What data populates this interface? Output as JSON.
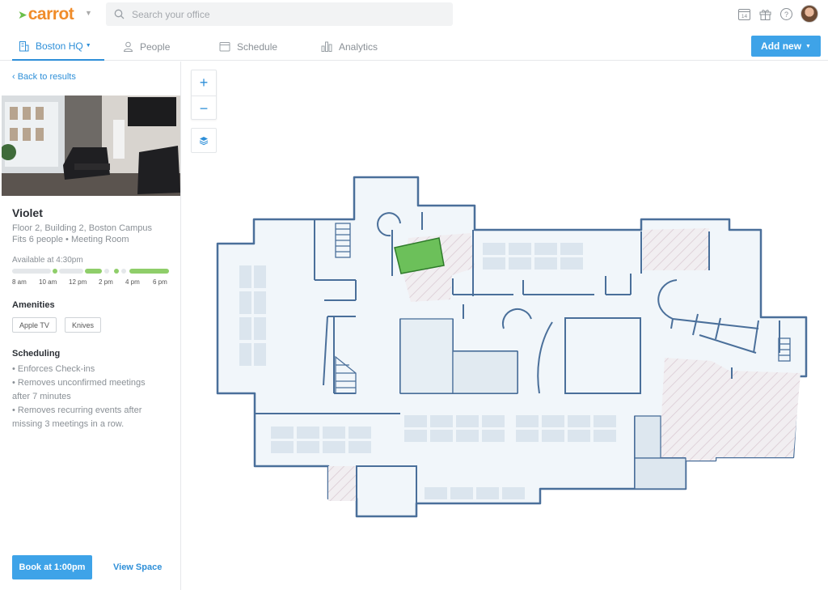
{
  "app": {
    "logo_text": "carrot"
  },
  "search": {
    "placeholder": "Search your office"
  },
  "top_icons": [
    "calendar-icon",
    "gift-icon",
    "help-icon",
    "avatar"
  ],
  "calendar_day": "14",
  "nav": {
    "tabs": [
      {
        "label": "Boston HQ",
        "icon": "building-icon",
        "active": true
      },
      {
        "label": "People",
        "icon": "person-icon",
        "active": false
      },
      {
        "label": "Schedule",
        "icon": "calendar-icon",
        "active": false
      },
      {
        "label": "Analytics",
        "icon": "bar-chart-icon",
        "active": false
      }
    ],
    "add_new": "Add new"
  },
  "sidebar": {
    "back": "‹ Back to results",
    "room_name": "Violet",
    "location": "Floor 2, Building 2, Boston Campus",
    "details": "Fits 6 people • Meeting Room",
    "available": "Available at 4:30pm",
    "timeline_labels": [
      "8 am",
      "10 am",
      "12 pm",
      "2 pm",
      "4 pm",
      "6 pm"
    ],
    "amenities_title": "Amenities",
    "amenities": [
      "Apple TV",
      "Knives"
    ],
    "scheduling_title": "Scheduling",
    "scheduling": [
      "• Enforces Check-ins",
      "• Removes unconfirmed meetings",
      "after 7 minutes",
      "• Removes recurring events after",
      "missing 3 meetings in a row."
    ],
    "book_button": "Book at 1:00pm",
    "view_space": "View Space"
  },
  "colors": {
    "accent": "#3ea3e8",
    "available": "#8fce6a",
    "busy": "#e4e7ea",
    "selected_room": "#6cc05a",
    "wall": "#4a6f9a",
    "floor": "#f1f6fa"
  }
}
